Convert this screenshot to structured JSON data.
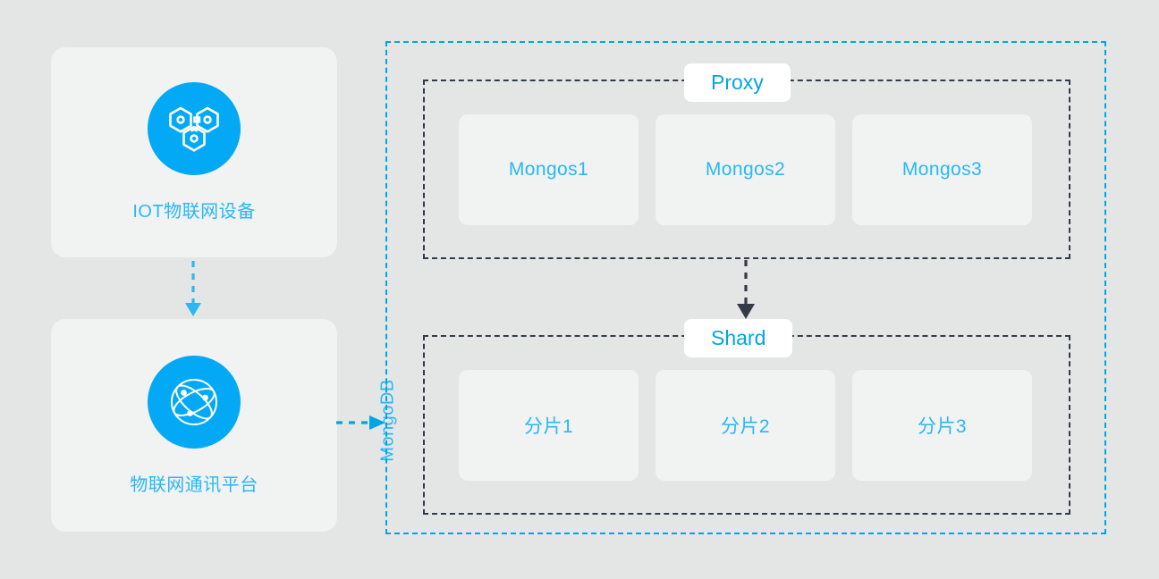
{
  "theme": {
    "page_background": "#e4e6e6",
    "card_background": "#f1f2f2",
    "accent_blue": "#03a9f4",
    "label_blue": "#2ab7f5",
    "title_blue": "#00a5e3",
    "dashed_dark": "#343b48",
    "dashed_blue": "#00a5e3",
    "pill_background": "#ffffff"
  },
  "sources": {
    "items": [
      {
        "id": "iot-device",
        "label": "IOT物联网设备",
        "icon": "hexagon-cluster-icon"
      },
      {
        "id": "iot-platform",
        "label": "物联网通讯平台",
        "icon": "globe-network-icon"
      }
    ]
  },
  "connectors": {
    "iot_to_platform": {
      "name": "dashed-arrow-down-icon",
      "direction": "down",
      "color": "#2ab7f5"
    },
    "platform_to_mongodb": {
      "name": "dashed-arrow-right-icon",
      "direction": "right",
      "color": "#00a5e3"
    },
    "proxy_to_shard": {
      "name": "dashed-arrow-down-icon",
      "direction": "down",
      "color": "#343b48"
    }
  },
  "mongodb": {
    "label": "MongoDB",
    "groups": [
      {
        "id": "proxy",
        "title": "Proxy",
        "nodes": [
          "Mongos1",
          "Mongos2",
          "Mongos3"
        ]
      },
      {
        "id": "shard",
        "title": "Shard",
        "nodes": [
          "分片1",
          "分片2",
          "分片3"
        ]
      }
    ]
  }
}
